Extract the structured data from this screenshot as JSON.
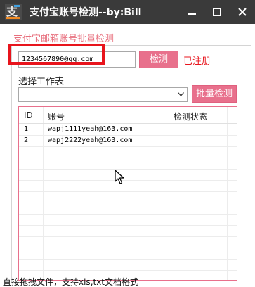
{
  "window": {
    "title": "支付宝账号检测--by:Bill",
    "app_icon": "app-logo-icon",
    "controls": [
      "minimize-icon",
      "maximize-icon",
      "close-icon"
    ]
  },
  "group": {
    "label": "支付宝邮箱账号批量检测"
  },
  "single_check": {
    "account_value": "1234567890@qq.com",
    "button_label": "检测",
    "result": "已注册",
    "result_color": "#e8141c"
  },
  "sheet": {
    "label": "选择工作表",
    "selected": ""
  },
  "batch": {
    "button_label": "批量检测"
  },
  "table": {
    "columns": [
      "ID",
      "账号",
      "检测状态"
    ],
    "rows": [
      {
        "id": "1",
        "account": "wapj1111yeah@163.com",
        "status": ""
      },
      {
        "id": "2",
        "account": "wapj2222yeah@163.com",
        "status": ""
      }
    ]
  },
  "hint": "直接拖拽文件，支持xls,txt文档格式",
  "colors": {
    "accent": "#e8708c",
    "titlebar": "#3a3a3a",
    "group_label": "#e8707e",
    "highlight": "#e8141c"
  }
}
